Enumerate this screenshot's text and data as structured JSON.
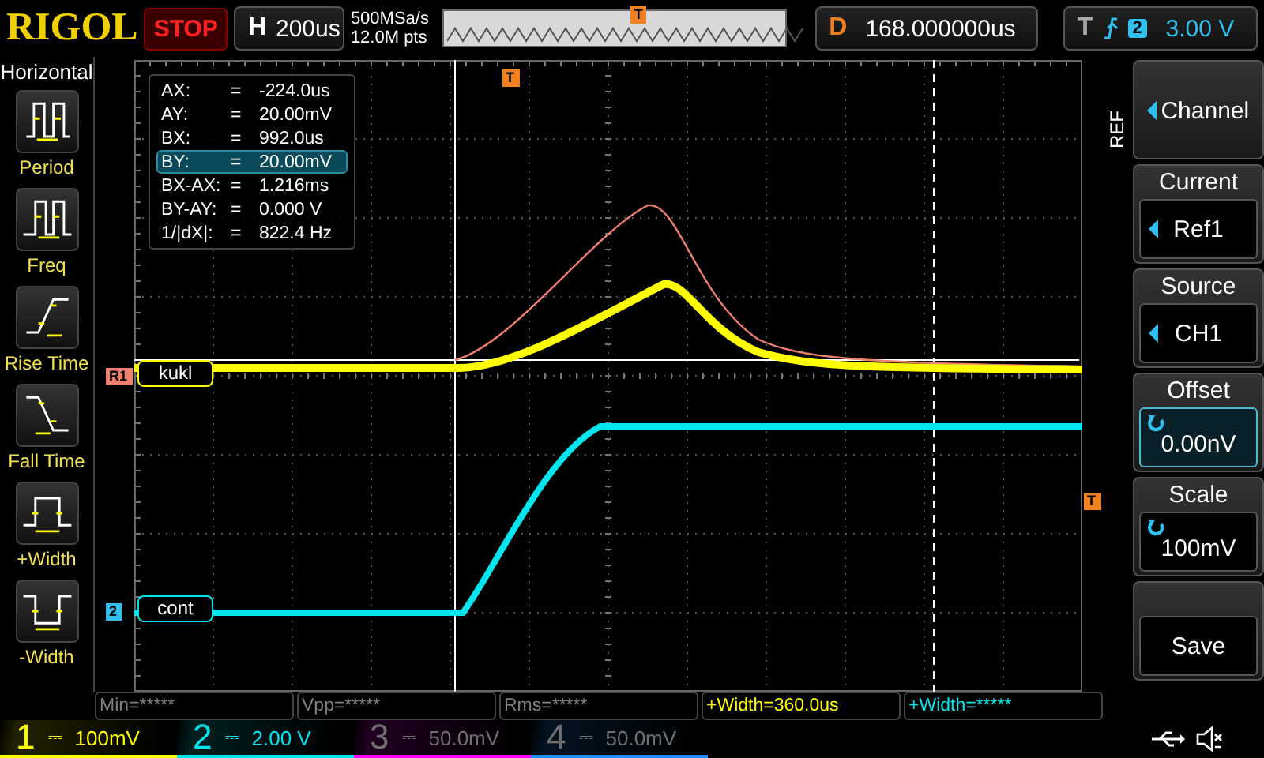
{
  "header": {
    "brand": "RIGOL",
    "run_state": "STOP",
    "timebase": {
      "label": "H",
      "value": "200us"
    },
    "sample_rate": "500MSa/s",
    "memory_depth": "12.0M pts",
    "overview_marker": "T",
    "delay": {
      "label": "D",
      "value": "168.000000us"
    },
    "trigger": {
      "label": "T",
      "source": "2",
      "level": "3.00 V"
    }
  },
  "sidebar": {
    "title": "Horizontal",
    "items": [
      {
        "kind": "period",
        "label": "Period"
      },
      {
        "kind": "freq",
        "label": "Freq"
      },
      {
        "kind": "rise",
        "label": "Rise Time"
      },
      {
        "kind": "fall",
        "label": "Fall Time"
      },
      {
        "kind": "pwidth",
        "label": "+Width"
      },
      {
        "kind": "nwidth",
        "label": "-Width"
      }
    ]
  },
  "cursor_readout": [
    {
      "label": "AX:",
      "separator": "=",
      "value": "-224.0us",
      "selected": false
    },
    {
      "label": "AY:",
      "separator": "=",
      "value": "20.00mV",
      "selected": false
    },
    {
      "label": "BX:",
      "separator": "=",
      "value": "992.0us",
      "selected": false
    },
    {
      "label": "BY:",
      "separator": "=",
      "value": "20.00mV",
      "selected": true
    },
    {
      "label": "BX-AX:",
      "separator": "=",
      "value": "1.216ms",
      "selected": false
    },
    {
      "label": "BY-AY:",
      "separator": "=",
      "value": "0.000 V",
      "selected": false
    },
    {
      "label": "1/|dX|:",
      "separator": "=",
      "value": "822.4 Hz",
      "selected": false
    }
  ],
  "waveform_area": {
    "time_marker": "T",
    "trigger_level_marker": "T",
    "traces": [
      {
        "marker": "R1",
        "label": "kukl",
        "color": "#ffff00"
      },
      {
        "marker": "2",
        "label": "cont",
        "color": "#00e5ee"
      }
    ]
  },
  "menu": {
    "tab": "REF",
    "items": [
      {
        "kind": "select",
        "value": "Channel",
        "selected": false
      },
      {
        "kind": "select",
        "title": "Current",
        "value": "Ref1",
        "selected": false
      },
      {
        "kind": "select",
        "title": "Source",
        "value": "CH1",
        "selected": false
      },
      {
        "kind": "knob",
        "title": "Offset",
        "value": "0.00nV",
        "selected": true
      },
      {
        "kind": "knob",
        "title": "Scale",
        "value": "100mV",
        "selected": false
      },
      {
        "kind": "button",
        "value": "Save",
        "selected": false
      }
    ]
  },
  "measurements": [
    {
      "text": "Min=*****",
      "color": "#808080"
    },
    {
      "text": "Vpp=*****",
      "color": "#808080"
    },
    {
      "text": "Rms=*****",
      "color": "#808080"
    },
    {
      "text": "+Width=360.0us",
      "color": "#ffff00"
    },
    {
      "text": "+Width=*****",
      "color": "#00e5ee"
    }
  ],
  "channels": [
    {
      "number": "1",
      "coupling": "⎓",
      "scale": "100mV",
      "enabled": true,
      "color": "#ffff00"
    },
    {
      "number": "2",
      "coupling": "⎓",
      "scale": "2.00 V",
      "enabled": true,
      "color": "#00e5ee"
    },
    {
      "number": "3",
      "coupling": "⎓",
      "scale": "50.0mV",
      "enabled": false,
      "color": "#ff00ff"
    },
    {
      "number": "4",
      "coupling": "⎓",
      "scale": "50.0mV",
      "enabled": false,
      "color": "#1e90ff"
    }
  ]
}
